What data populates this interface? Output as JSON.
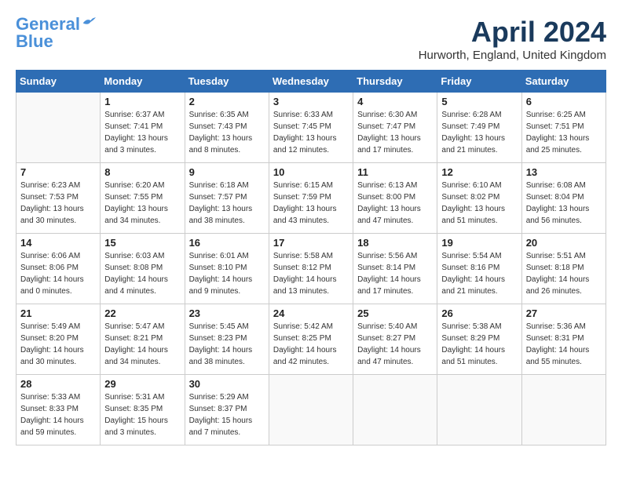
{
  "header": {
    "logo_line1": "General",
    "logo_line2": "Blue",
    "month_title": "April 2024",
    "location": "Hurworth, England, United Kingdom"
  },
  "days_of_week": [
    "Sunday",
    "Monday",
    "Tuesday",
    "Wednesday",
    "Thursday",
    "Friday",
    "Saturday"
  ],
  "weeks": [
    [
      {
        "day": "",
        "info": ""
      },
      {
        "day": "1",
        "info": "Sunrise: 6:37 AM\nSunset: 7:41 PM\nDaylight: 13 hours\nand 3 minutes."
      },
      {
        "day": "2",
        "info": "Sunrise: 6:35 AM\nSunset: 7:43 PM\nDaylight: 13 hours\nand 8 minutes."
      },
      {
        "day": "3",
        "info": "Sunrise: 6:33 AM\nSunset: 7:45 PM\nDaylight: 13 hours\nand 12 minutes."
      },
      {
        "day": "4",
        "info": "Sunrise: 6:30 AM\nSunset: 7:47 PM\nDaylight: 13 hours\nand 17 minutes."
      },
      {
        "day": "5",
        "info": "Sunrise: 6:28 AM\nSunset: 7:49 PM\nDaylight: 13 hours\nand 21 minutes."
      },
      {
        "day": "6",
        "info": "Sunrise: 6:25 AM\nSunset: 7:51 PM\nDaylight: 13 hours\nand 25 minutes."
      }
    ],
    [
      {
        "day": "7",
        "info": "Sunrise: 6:23 AM\nSunset: 7:53 PM\nDaylight: 13 hours\nand 30 minutes."
      },
      {
        "day": "8",
        "info": "Sunrise: 6:20 AM\nSunset: 7:55 PM\nDaylight: 13 hours\nand 34 minutes."
      },
      {
        "day": "9",
        "info": "Sunrise: 6:18 AM\nSunset: 7:57 PM\nDaylight: 13 hours\nand 38 minutes."
      },
      {
        "day": "10",
        "info": "Sunrise: 6:15 AM\nSunset: 7:59 PM\nDaylight: 13 hours\nand 43 minutes."
      },
      {
        "day": "11",
        "info": "Sunrise: 6:13 AM\nSunset: 8:00 PM\nDaylight: 13 hours\nand 47 minutes."
      },
      {
        "day": "12",
        "info": "Sunrise: 6:10 AM\nSunset: 8:02 PM\nDaylight: 13 hours\nand 51 minutes."
      },
      {
        "day": "13",
        "info": "Sunrise: 6:08 AM\nSunset: 8:04 PM\nDaylight: 13 hours\nand 56 minutes."
      }
    ],
    [
      {
        "day": "14",
        "info": "Sunrise: 6:06 AM\nSunset: 8:06 PM\nDaylight: 14 hours\nand 0 minutes."
      },
      {
        "day": "15",
        "info": "Sunrise: 6:03 AM\nSunset: 8:08 PM\nDaylight: 14 hours\nand 4 minutes."
      },
      {
        "day": "16",
        "info": "Sunrise: 6:01 AM\nSunset: 8:10 PM\nDaylight: 14 hours\nand 9 minutes."
      },
      {
        "day": "17",
        "info": "Sunrise: 5:58 AM\nSunset: 8:12 PM\nDaylight: 14 hours\nand 13 minutes."
      },
      {
        "day": "18",
        "info": "Sunrise: 5:56 AM\nSunset: 8:14 PM\nDaylight: 14 hours\nand 17 minutes."
      },
      {
        "day": "19",
        "info": "Sunrise: 5:54 AM\nSunset: 8:16 PM\nDaylight: 14 hours\nand 21 minutes."
      },
      {
        "day": "20",
        "info": "Sunrise: 5:51 AM\nSunset: 8:18 PM\nDaylight: 14 hours\nand 26 minutes."
      }
    ],
    [
      {
        "day": "21",
        "info": "Sunrise: 5:49 AM\nSunset: 8:20 PM\nDaylight: 14 hours\nand 30 minutes."
      },
      {
        "day": "22",
        "info": "Sunrise: 5:47 AM\nSunset: 8:21 PM\nDaylight: 14 hours\nand 34 minutes."
      },
      {
        "day": "23",
        "info": "Sunrise: 5:45 AM\nSunset: 8:23 PM\nDaylight: 14 hours\nand 38 minutes."
      },
      {
        "day": "24",
        "info": "Sunrise: 5:42 AM\nSunset: 8:25 PM\nDaylight: 14 hours\nand 42 minutes."
      },
      {
        "day": "25",
        "info": "Sunrise: 5:40 AM\nSunset: 8:27 PM\nDaylight: 14 hours\nand 47 minutes."
      },
      {
        "day": "26",
        "info": "Sunrise: 5:38 AM\nSunset: 8:29 PM\nDaylight: 14 hours\nand 51 minutes."
      },
      {
        "day": "27",
        "info": "Sunrise: 5:36 AM\nSunset: 8:31 PM\nDaylight: 14 hours\nand 55 minutes."
      }
    ],
    [
      {
        "day": "28",
        "info": "Sunrise: 5:33 AM\nSunset: 8:33 PM\nDaylight: 14 hours\nand 59 minutes."
      },
      {
        "day": "29",
        "info": "Sunrise: 5:31 AM\nSunset: 8:35 PM\nDaylight: 15 hours\nand 3 minutes."
      },
      {
        "day": "30",
        "info": "Sunrise: 5:29 AM\nSunset: 8:37 PM\nDaylight: 15 hours\nand 7 minutes."
      },
      {
        "day": "",
        "info": ""
      },
      {
        "day": "",
        "info": ""
      },
      {
        "day": "",
        "info": ""
      },
      {
        "day": "",
        "info": ""
      }
    ]
  ]
}
